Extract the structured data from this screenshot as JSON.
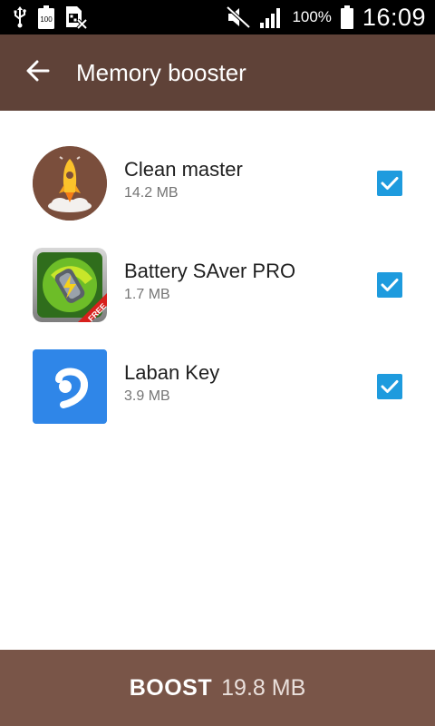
{
  "status_bar": {
    "battery_icon_text": "100",
    "battery_level": "100%",
    "time": "16:09",
    "icons": [
      "usb-icon",
      "battery-100-icon",
      "sim-off-icon",
      "mute-icon",
      "signal-icon",
      "battery-icon"
    ]
  },
  "header": {
    "title": "Memory booster",
    "back_icon": "arrow-left-icon"
  },
  "apps": [
    {
      "name": "Clean master",
      "size": "14.2 MB",
      "checked": true,
      "icon": "rocket-icon"
    },
    {
      "name": "Battery SAver PRO",
      "size": "1.7 MB",
      "checked": true,
      "icon": "battery-saver-icon",
      "badge": "FREE"
    },
    {
      "name": "Laban Key",
      "size": "3.9 MB",
      "checked": true,
      "icon": "laban-key-icon"
    }
  ],
  "footer": {
    "boost_label": "BOOST",
    "boost_size": "19.8 MB"
  },
  "colors": {
    "app_bar": "#5f4238",
    "footer": "#795548",
    "checkbox": "#1e9bde"
  }
}
